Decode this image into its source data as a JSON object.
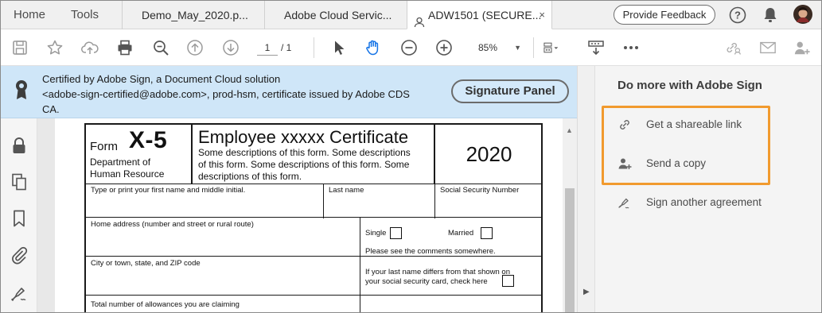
{
  "nav": {
    "home": "Home",
    "tools": "Tools"
  },
  "tabs": [
    {
      "label": "Demo_May_2020.p..."
    },
    {
      "label": "Adobe Cloud Servic..."
    },
    {
      "label": "ADW1501 (SECURE...",
      "close": "×"
    }
  ],
  "header": {
    "feedback_label": "Provide Feedback"
  },
  "toolbar": {
    "page_current": "1",
    "page_total": "/ 1",
    "zoom": "85%"
  },
  "banner": {
    "line1": "Certified by Adobe Sign, a Document Cloud solution",
    "line2": "<adobe-sign-certified@adobe.com>, prod-hsm, certificate issued by Adobe CDS",
    "line3": "CA.",
    "signature_panel": "Signature Panel"
  },
  "form": {
    "form_word": "Form",
    "form_number": "X-5",
    "dept_line1": "Department of",
    "dept_line2": "Human Resource",
    "title": "Employee xxxxx Certificate",
    "desc1": "Some descriptions of this form. Some descriptions",
    "desc2": "of this form. Some descriptions of this form. Some",
    "desc3": "descriptions of this form.",
    "year": "2020",
    "first_name_label": "Type or print your first name and middle initial.",
    "last_name_label": "Last name",
    "ssn_label": "Social Security Number",
    "address_label": "Home address (number and street or rural route)",
    "single_label": "Single",
    "married_label": "Married",
    "comments_note": "Please see the comments somewhere.",
    "city_label": "City or town, state, and ZIP code",
    "diff_line1": "If your last name differs from that shown on",
    "diff_line2": "your social security card, check here",
    "allowances_label": "Total number of allowances you are claiming"
  },
  "right_panel": {
    "title": "Do more with Adobe Sign",
    "items": [
      {
        "label": "Get a shareable link",
        "icon": "link-icon"
      },
      {
        "label": "Send a copy",
        "icon": "add-user-icon"
      },
      {
        "label": "Sign another agreement",
        "icon": "sign-pen-icon"
      }
    ],
    "highlight_color": "#F19A2E"
  },
  "colors": {
    "banner": "#CFE6F8",
    "accent_hand": "#1473E6"
  }
}
